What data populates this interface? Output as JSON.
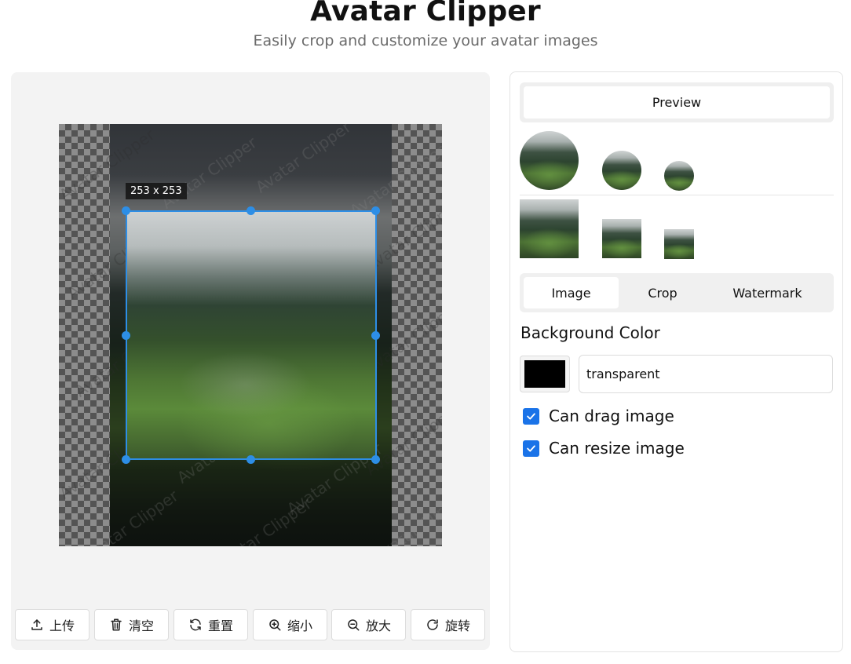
{
  "header": {
    "title": "Avatar Clipper",
    "subtitle": "Easily crop and customize your avatar images"
  },
  "editor": {
    "crop_size_label": "253 x 253",
    "watermark_text": "Avatar Clipper"
  },
  "toolbar": {
    "upload": "上传",
    "clear": "清空",
    "reset": "重置",
    "zoom_out": "缩小",
    "zoom_in": "放大",
    "rotate": "旋转"
  },
  "sidebar": {
    "preview_button": "Preview",
    "tabs": [
      "Image",
      "Crop",
      "Watermark"
    ],
    "active_tab": "Image",
    "background_color_label": "Background Color",
    "background_color_value": "transparent",
    "background_swatch_color": "#000000",
    "can_drag_label": "Can drag image",
    "can_drag_checked": true,
    "can_resize_label": "Can resize image",
    "can_resize_checked": true
  },
  "colors": {
    "accent": "#2d8ee6",
    "checkbox": "#1a73e8"
  }
}
